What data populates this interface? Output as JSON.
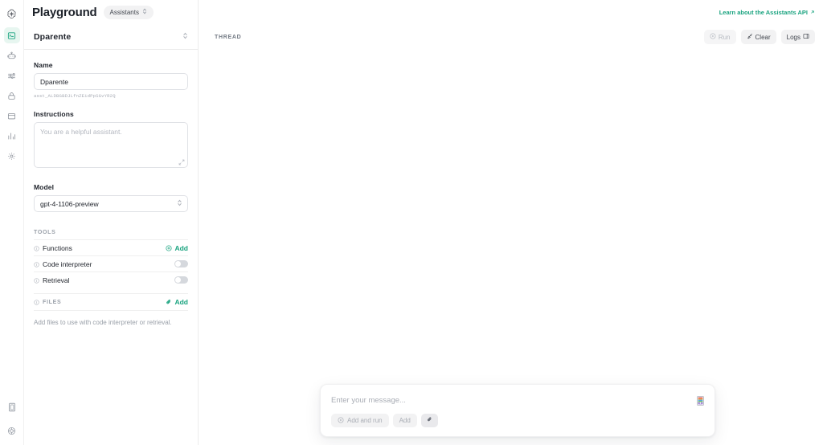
{
  "header": {
    "title": "Playground",
    "mode_pill": "Assistants",
    "learn_link": "Learn about the Assistants API"
  },
  "rail": {
    "logo_name": "openai-logo",
    "items": [
      {
        "name": "sidebar-item-playground",
        "icon": "playground-icon",
        "active": true
      },
      {
        "name": "sidebar-item-assistants",
        "icon": "assistants-icon",
        "active": false
      },
      {
        "name": "sidebar-item-fine-tuning",
        "icon": "sliders-icon",
        "active": false
      },
      {
        "name": "sidebar-item-api-keys",
        "icon": "lock-icon",
        "active": false
      },
      {
        "name": "sidebar-item-files",
        "icon": "folder-icon",
        "active": false
      },
      {
        "name": "sidebar-item-usage",
        "icon": "bar-chart-icon",
        "active": false
      },
      {
        "name": "sidebar-item-settings",
        "icon": "gear-icon",
        "active": false
      }
    ],
    "bottom_items": [
      {
        "name": "sidebar-item-docs",
        "icon": "book-icon"
      },
      {
        "name": "sidebar-item-help",
        "icon": "help-circle-icon"
      }
    ]
  },
  "config": {
    "assistant_selector_value": "Dparente",
    "name_label": "Name",
    "name_value": "Dparente",
    "assistant_id": "asst_ALDBGBDJLfnZEidPpSGvYR2Q",
    "instructions_label": "Instructions",
    "instructions_value": "",
    "instructions_placeholder": "You are a helpful assistant.",
    "model_label": "Model",
    "model_value": "gpt-4-1106-preview",
    "tools_caption": "TOOLS",
    "tools": [
      {
        "label": "Functions",
        "control": "add",
        "add_label": "Add",
        "enabled": false
      },
      {
        "label": "Code interpreter",
        "control": "toggle",
        "enabled": false
      },
      {
        "label": "Retrieval",
        "control": "toggle",
        "enabled": false
      }
    ],
    "files_caption": "FILES",
    "files_add_label": "Add",
    "files_hint": "Add files to use with code interpreter or retrieval."
  },
  "thread": {
    "caption": "THREAD",
    "buttons": [
      {
        "label": "Run",
        "icon": "play-circle-icon",
        "disabled": true,
        "name": "run-button"
      },
      {
        "label": "Clear",
        "icon": "broom-icon",
        "disabled": false,
        "name": "clear-button"
      },
      {
        "label": "Logs",
        "icon": "panel-right-icon",
        "disabled": false,
        "name": "logs-button"
      }
    ]
  },
  "composer": {
    "placeholder": "Enter your message...",
    "value": "",
    "add_and_run_label": "Add and run",
    "add_label": "Add",
    "attach_icon": "paperclip-icon",
    "password_manager_icon": "password-manager-icon"
  },
  "colors": {
    "accent_green": "#19a37f",
    "active_bg": "#e7f6f0",
    "text_primary": "#20242c",
    "text_muted": "#9aa0a9",
    "border": "#e0e2e6",
    "chip_bg": "#f2f2f3"
  }
}
